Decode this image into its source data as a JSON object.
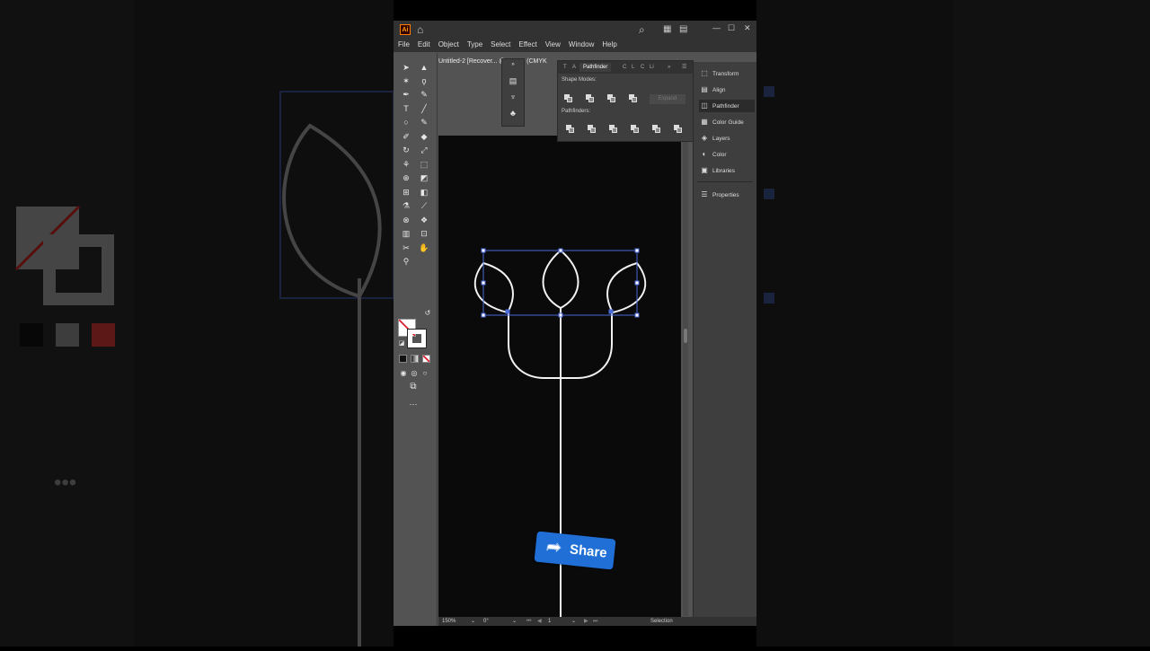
{
  "app": {
    "logo_text": "Ai",
    "menu": [
      "File",
      "Edit",
      "Object",
      "Type",
      "Select",
      "Effect",
      "View",
      "Window",
      "Help"
    ],
    "document_tab": "Untitled-2 [Recover... @ 150 % (CMYK"
  },
  "pathfinder": {
    "tabs": [
      "T",
      "A",
      "Pathfinder",
      "C",
      "L",
      "C",
      "Li"
    ],
    "shape_modes_label": "Shape Modes:",
    "pathfinders_label": "Pathfinders:",
    "expand_label": "Expand"
  },
  "right_dock": {
    "items": [
      "Transform",
      "Align",
      "Pathfinder",
      "Color Guide",
      "Layers",
      "Color",
      "Libraries",
      "Properties"
    ],
    "active": "Pathfinder"
  },
  "status": {
    "zoom": "150%",
    "rotation": "0°",
    "artboard": "1",
    "tool": "Selection"
  },
  "overlay": {
    "share_label": "Share"
  },
  "colors": {
    "accent": "#1f6fd6",
    "selection": "#4a6bd8",
    "canvas": "#0a0a0a"
  }
}
